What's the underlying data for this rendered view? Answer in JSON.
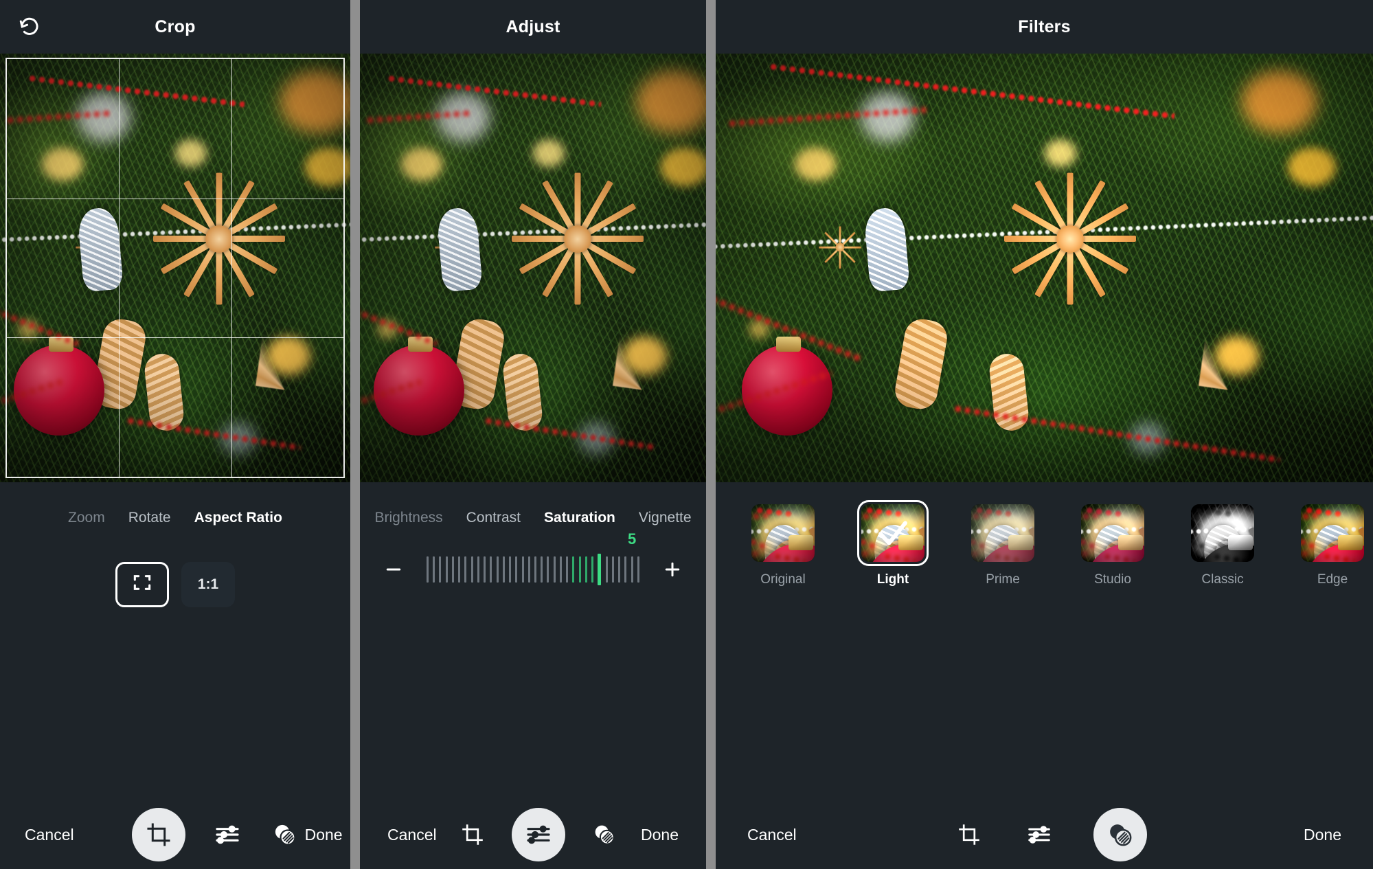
{
  "app": {
    "background_color": "#1e2429",
    "accent_color": "#3ddc84",
    "divider_color": "#8f8f8f"
  },
  "panels": [
    {
      "id": "crop",
      "header": {
        "title": "Crop",
        "undo_icon": "rotate-left-icon"
      },
      "tool_tabs": [
        {
          "label": "Zoom",
          "state": "dim"
        },
        {
          "label": "Rotate",
          "state": "normal"
        },
        {
          "label": "Aspect Ratio",
          "state": "active"
        }
      ],
      "aspect_ratios": [
        {
          "label": "",
          "icon": "free-crop-icon",
          "selected": true
        },
        {
          "label": "1:1",
          "icon": "",
          "selected": false
        }
      ],
      "crop_overlay": {
        "grid": "rule-of-thirds",
        "frame_color": "#ffffff"
      },
      "bottom_bar": {
        "cancel_label": "Cancel",
        "done_label": "Done",
        "icons": [
          {
            "name": "crop-icon",
            "active": true
          },
          {
            "name": "adjust-icon",
            "active": false
          },
          {
            "name": "filters-icon",
            "active": false
          }
        ]
      }
    },
    {
      "id": "adjust",
      "header": {
        "title": "Adjust",
        "undo_icon": ""
      },
      "tool_tabs": [
        {
          "label": "Brightness",
          "state": "dim"
        },
        {
          "label": "Contrast",
          "state": "normal"
        },
        {
          "label": "Saturation",
          "state": "active"
        },
        {
          "label": "Vignette",
          "state": "normal"
        }
      ],
      "slider": {
        "value": "5",
        "value_color": "#3ddc84",
        "minus_label": "minus-icon",
        "plus_label": "plus-icon",
        "ticks_total": 34,
        "ticks_filled": 23,
        "current_tick": 27
      },
      "bottom_bar": {
        "cancel_label": "Cancel",
        "done_label": "Done",
        "icons": [
          {
            "name": "crop-icon",
            "active": false
          },
          {
            "name": "adjust-icon",
            "active": true
          },
          {
            "name": "filters-icon",
            "active": false
          }
        ]
      }
    },
    {
      "id": "filters",
      "header": {
        "title": "Filters",
        "undo_icon": ""
      },
      "filters": [
        {
          "label": "Original",
          "selected": false,
          "look": "look-original"
        },
        {
          "label": "Light",
          "selected": true,
          "look": "look-light"
        },
        {
          "label": "Prime",
          "selected": false,
          "look": "look-prime"
        },
        {
          "label": "Studio",
          "selected": false,
          "look": "look-studio"
        },
        {
          "label": "Classic",
          "selected": false,
          "look": "look-classic"
        },
        {
          "label": "Edge",
          "selected": false,
          "look": "look-edge"
        }
      ],
      "bottom_bar": {
        "cancel_label": "Cancel",
        "done_label": "Done",
        "icons": [
          {
            "name": "crop-icon",
            "active": false
          },
          {
            "name": "adjust-icon",
            "active": false
          },
          {
            "name": "filters-icon",
            "active": true
          }
        ]
      }
    }
  ]
}
